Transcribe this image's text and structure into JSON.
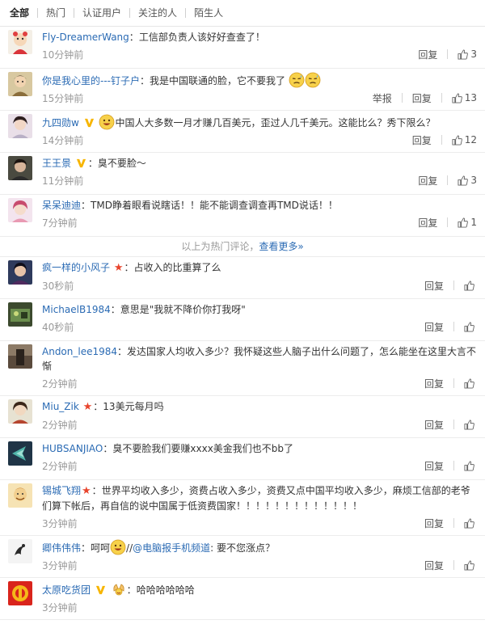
{
  "tabs": [
    {
      "label": "全部",
      "active": true
    },
    {
      "label": "热门"
    },
    {
      "label": "认证用户"
    },
    {
      "label": "关注的人"
    },
    {
      "label": "陌生人"
    }
  ],
  "actions": {
    "reply": "回复",
    "report": "举报"
  },
  "hot_comments": [
    {
      "user": "Fly-DreamerWang",
      "text": "工信部负责人该好好查查了！",
      "time": "10分钟前",
      "likes": "3"
    },
    {
      "user": "你是我心里的---钉子户",
      "text": "我是中国联通的脸，它不要我了",
      "time": "15分钟前",
      "likes": "13",
      "emoji_icons": [
        "sweat-face-emoji",
        "sweat-face-emoji"
      ]
    },
    {
      "user": "九四勋w",
      "text": "中国人大多数一月才赚几百美元，歪过人几千美元。这能比么？秀下限么？",
      "time": "14分钟前",
      "likes": "12",
      "emoji_icons": [
        "grin-face-emoji"
      ]
    },
    {
      "user": "王王景",
      "text": "臭不要脸～",
      "time": "11分钟前",
      "likes": "3"
    },
    {
      "user": "呆呆迪迪",
      "text": "TMD睁着眼看说瞎话！！能不能调查调查再TMD说话！！",
      "time": "7分钟前",
      "likes": "1"
    }
  ],
  "hot_footer": {
    "text": "以上为热门评论，",
    "link": "查看更多»"
  },
  "comments": [
    {
      "user": "疯一样的小风子",
      "text": "占收入的比重算了么",
      "time": "30秒前"
    },
    {
      "user": "MichaelB1984",
      "text": "意思是\"我就不降价你打我呀\"",
      "time": "40秒前"
    },
    {
      "user": "Andon_lee1984",
      "text": "发达国家人均收入多少？我怀疑这些人脑子出什么问题了，怎么能坐在这里大言不惭",
      "time": "2分钟前"
    },
    {
      "user": "Miu_Zik",
      "text": "13美元每月吗",
      "time": "2分钟前"
    },
    {
      "user": "HUBSANJIAO",
      "text": "臭不要脸我们要赚xxxx美金我们也不bb了",
      "time": "2分钟前"
    },
    {
      "user": "锡城飞翔",
      "text": "世界平均收入多少，资费占收入多少，资费又点中国平均收入多少，麻烦工信部的老爷们算下帐后，再自信的说中国属于低资费国家！！！！！！！！！！！！！",
      "time": "3分钟前"
    },
    {
      "user": "卿伟伟伟",
      "text_pre": "呵呵",
      "emoji_icons": [
        "grin-face-emoji"
      ],
      "text_mid": "//",
      "mention": "@电脑报手机频道",
      "text_post": ": 要不您涨点？",
      "time": "3分钟前"
    },
    {
      "user": "太原吃货团",
      "text": "哈哈哈哈哈哈",
      "time": "3分钟前",
      "emoji_icons": [
        "clap-hands-emoji"
      ]
    }
  ],
  "colors": {
    "link": "#2b6bb4",
    "star": "#e8442c",
    "vip": "#f7b500",
    "time": "#999999"
  }
}
